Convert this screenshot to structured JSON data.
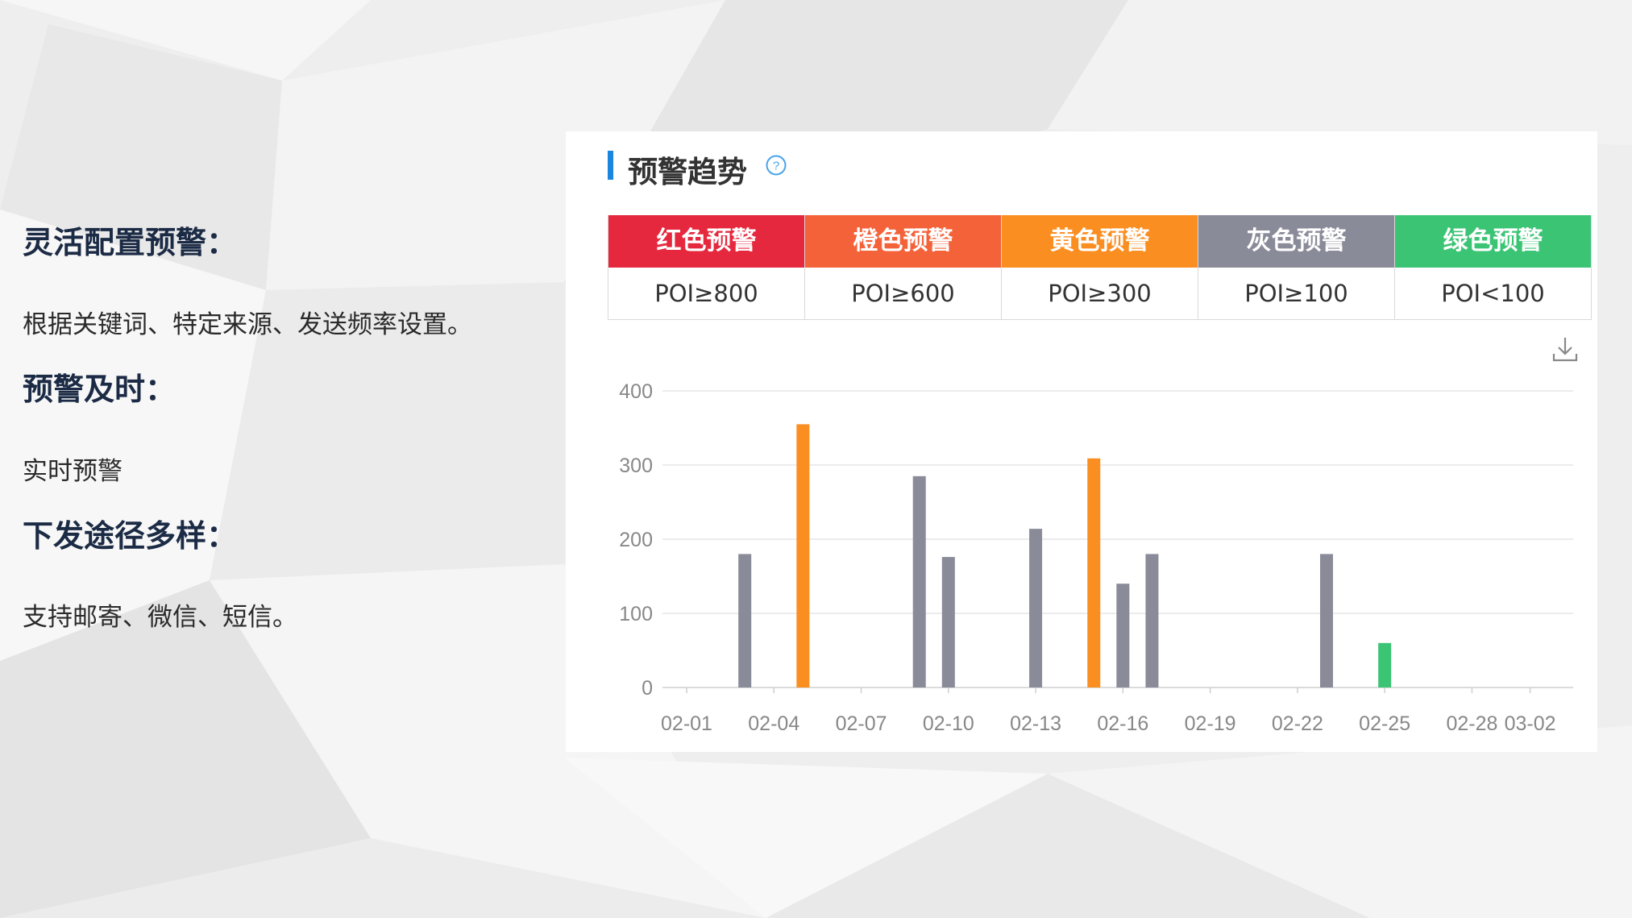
{
  "left_panel": {
    "sections": [
      {
        "heading": "灵活配置预警：",
        "text": "根据关键词、特定来源、发送频率设置。"
      },
      {
        "heading": "预警及时：",
        "text": "实时预警"
      },
      {
        "heading": "下发途径多样：",
        "text": "支持邮寄、微信、短信。"
      }
    ]
  },
  "card": {
    "title": "预警趋势",
    "help_icon": "question-circle-icon",
    "download_icon": "download-icon",
    "levels": [
      {
        "name": "红色预警",
        "rule": "POI≥800",
        "color": "#e5283d"
      },
      {
        "name": "橙色预警",
        "rule": "POI≥600",
        "color": "#f4623a"
      },
      {
        "name": "黄色预警",
        "rule": "POI≥300",
        "color": "#fb8e20"
      },
      {
        "name": "灰色预警",
        "rule": "POI≥100",
        "color": "#8a8b99"
      },
      {
        "name": "绿色预警",
        "rule": "POI<100",
        "color": "#3cc475"
      }
    ]
  },
  "chart_data": {
    "type": "bar",
    "title": "",
    "xlabel": "",
    "ylabel": "",
    "ylim": [
      0,
      400
    ],
    "yticks": [
      0,
      100,
      200,
      300,
      400
    ],
    "xticks": [
      "02-01",
      "02-04",
      "02-07",
      "02-10",
      "02-13",
      "02-16",
      "02-19",
      "02-22",
      "02-25",
      "02-28",
      "03-02"
    ],
    "grid": true,
    "bars": [
      {
        "date": "02-03",
        "value": 180,
        "color": "#8a8b99"
      },
      {
        "date": "02-05",
        "value": 355,
        "color": "#fb8e20"
      },
      {
        "date": "02-09",
        "value": 285,
        "color": "#8a8b99"
      },
      {
        "date": "02-10",
        "value": 176,
        "color": "#8a8b99"
      },
      {
        "date": "02-13",
        "value": 214,
        "color": "#8a8b99"
      },
      {
        "date": "02-15",
        "value": 309,
        "color": "#fb8e20"
      },
      {
        "date": "02-16",
        "value": 140,
        "color": "#8a8b99"
      },
      {
        "date": "02-17",
        "value": 180,
        "color": "#8a8b99"
      },
      {
        "date": "02-23",
        "value": 180,
        "color": "#8a8b99"
      },
      {
        "date": "02-25",
        "value": 60,
        "color": "#3cc475"
      }
    ]
  }
}
